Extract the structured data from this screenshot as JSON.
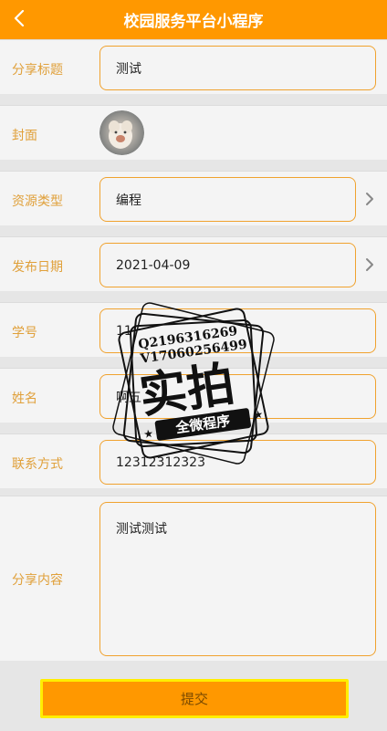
{
  "header": {
    "title": "校园服务平台小程序"
  },
  "form": {
    "share_title": {
      "label": "分享标题",
      "value": "测试"
    },
    "cover": {
      "label": "封面"
    },
    "resource_type": {
      "label": "资源类型",
      "value": "编程"
    },
    "publish_date": {
      "label": "发布日期",
      "value": "2021-04-09"
    },
    "student_id": {
      "label": "学号",
      "value": "11"
    },
    "name": {
      "label": "姓名",
      "value": "啊五"
    },
    "contact": {
      "label": "联系方式",
      "value": "12312312323"
    },
    "content": {
      "label": "分享内容",
      "value": "测试测试"
    }
  },
  "submit_label": "提交",
  "watermark": {
    "line1": "Q2196316269",
    "line2": "V17060256499",
    "main": "实拍",
    "sub": "全微程序"
  },
  "colors": {
    "accent": "#ff9800",
    "label": "#e0a03a",
    "border": "#f0a22e",
    "submit_border": "#ffee00"
  }
}
